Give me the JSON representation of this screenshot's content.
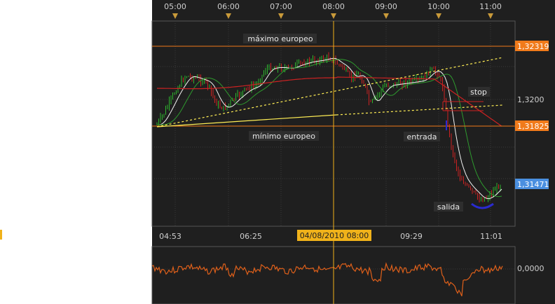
{
  "top_axis": {
    "time_labels": [
      "05:00",
      "06:00",
      "07:00",
      "08:00",
      "09:00",
      "10:00",
      "11:00"
    ]
  },
  "bottom_axis": {
    "time_labels": [
      "04:53",
      "06:25",
      "09:29",
      "11:01"
    ],
    "cursor_label": "04/08/2010 08:00"
  },
  "price_scale": {
    "tick_label": "1,3200",
    "tags": [
      {
        "text": "1,32319",
        "color": "#f07a1a",
        "text_color": "#ffffff"
      },
      {
        "text": "1,31825",
        "color": "#f07a1a",
        "text_color": "#ffffff"
      },
      {
        "text": "1,31471",
        "color": "#4a8fe0",
        "text_color": "#ffffff"
      }
    ]
  },
  "oscillator_scale": {
    "tick_label": "0,0000"
  },
  "annotations": {
    "maximo": "máximo europeo",
    "minimo": "mínimo europeo",
    "stop": "stop",
    "entrada": "entrada",
    "salida": "salida"
  },
  "colors": {
    "background": "#1f1f1f",
    "grid": "#3a3a3a",
    "axis_text": "#cfcfcf",
    "level_line": "#f07a1a",
    "cursor_line": "#f0b21a",
    "candle_up": "#2db52d",
    "candle_down": "#cc2222",
    "ma_fast": "#f2f2f2",
    "ma_mid": "#2e9a2e",
    "ma_slow": "#cc2222",
    "trend_yellow": "#ffee55",
    "oscillator": "#e0601a",
    "salida_marker": "#2a2ad0",
    "label_bg": "#2e2e2e",
    "marker_triangle": "#c99a3a"
  }
}
